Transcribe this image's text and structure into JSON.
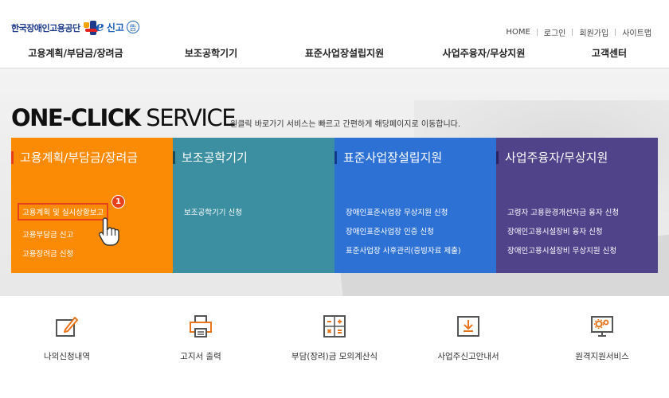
{
  "header": {
    "logo_text": "한국장애인고용공단",
    "elogo_e": "e",
    "elogo_text": "신고",
    "elogo_mark": "告",
    "util_links": [
      "HOME",
      "로그인",
      "회원가입",
      "사이트맵"
    ],
    "gnb": [
      "고용계획/부담금/장려금",
      "보조공학기기",
      "표준사업장설립지원",
      "사업주융자/무상지원",
      "고객센터"
    ]
  },
  "hero": {
    "title_bold": "ONE-CLICK",
    "title_rest": " SERVICE",
    "subtitle": "원클릭 바로가기 서비스는 빠르고 간편하게 해당페이지로 이동합니다."
  },
  "cards": [
    {
      "title": "고용계획/부담금/장려금",
      "color": "#fb8a05",
      "bar": "#e8401c",
      "links": [
        "고용계획 및 실시상황보고",
        "고용부담금 신고",
        "고용장려금 신청"
      ]
    },
    {
      "title": "보조공학기기",
      "color": "#3b8fa0",
      "bar": "#1c4a57",
      "links": [
        "보조공학기기 신청"
      ]
    },
    {
      "title": "표준사업장설립지원",
      "color": "#2e71d5",
      "bar": "#12398a",
      "links": [
        "장애인표준사업장 무상지원 신청",
        "장애인표준사업장 인증 신청",
        "표준사업장 사후관리(증빙자료 제출)"
      ]
    },
    {
      "title": "사업주융자/무상지원",
      "color": "#50438a",
      "bar": "#2b2261",
      "links": [
        "고령자 고용환경개선자금 융자 신청",
        "장애인고용시설장비 융자 신청",
        "장애인고용시설장비 무상지원 신청"
      ]
    }
  ],
  "step_badge": "1",
  "quick_menu": [
    {
      "label": "나의신청내역",
      "icon": "edit-note-icon"
    },
    {
      "label": "고지서 출력",
      "icon": "printer-icon"
    },
    {
      "label": "부담(장려)금 모의계산식",
      "icon": "calculator-icon"
    },
    {
      "label": "사업주신고안내서",
      "icon": "download-monitor-icon"
    },
    {
      "label": "원격지원서비스",
      "icon": "remote-gear-icon"
    }
  ],
  "colors": {
    "accent_orange": "#fb8a05",
    "highlight_red": "#e8401c",
    "icon_dark": "#555555",
    "icon_accent": "#e8741c"
  }
}
